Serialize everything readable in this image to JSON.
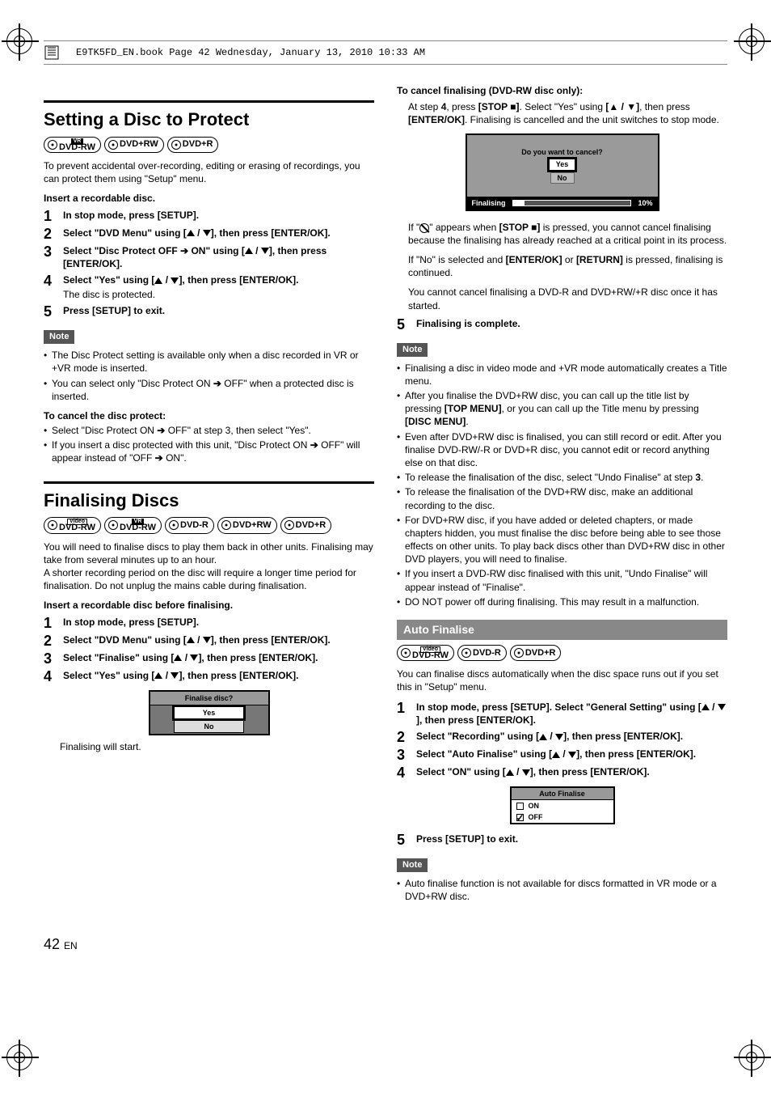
{
  "header_line": "E9TK5FD_EN.book  Page 42  Wednesday, January 13, 2010  10:33 AM",
  "left": {
    "section1_title": "Setting a Disc to Protect",
    "badges1": [
      "DVD-RW",
      "DVD+RW",
      "DVD+R"
    ],
    "badges1_sup": [
      "VR",
      "",
      ""
    ],
    "intro1": "To prevent accidental over-recording, editing or erasing of recordings, you can protect them using \"Setup\" menu.",
    "insert1": "Insert a recordable disc.",
    "steps1": [
      {
        "n": "1",
        "main": "In stop mode, press [SETUP]."
      },
      {
        "n": "2",
        "main": "Select \"DVD Menu\" using [▲ / ▼], then press [ENTER/OK]."
      },
      {
        "n": "3",
        "main": "Select \"Disc Protect OFF ➔ ON\" using [▲ / ▼], then press [ENTER/OK]."
      },
      {
        "n": "4",
        "main": "Select \"Yes\" using [▲ / ▼], then press [ENTER/OK].",
        "sub": "The disc is protected."
      },
      {
        "n": "5",
        "main": "Press [SETUP] to exit."
      }
    ],
    "note1_label": "Note",
    "note1_bullets": [
      "The Disc Protect setting is available only when a disc recorded in VR or +VR mode is inserted.",
      "You can select only \"Disc Protect ON ➔ OFF\" when a protected disc is inserted."
    ],
    "cancel_protect_h": "To cancel the disc protect:",
    "cancel_protect_bullets": [
      "Select \"Disc Protect ON ➔ OFF\" at step 3, then select \"Yes\".",
      "If you insert a disc protected with this unit, \"Disc Protect ON ➔ OFF\" will appear instead of \"OFF ➔ ON\"."
    ],
    "section2_title": "Finalising Discs",
    "badges2": [
      "DVD-RW",
      "DVD-RW",
      "DVD-R",
      "DVD+RW",
      "DVD+R"
    ],
    "badges2_sup": [
      "Video",
      "VR",
      "",
      "",
      ""
    ],
    "intro2": "You will need to finalise discs to play them back in other units. Finalising may take from several minutes up to an hour.\nA shorter recording period on the disc will require a longer time period for finalisation. Do not unplug the mains cable during finalisation.",
    "insert2": "Insert a recordable disc before finalising.",
    "steps2": [
      {
        "n": "1",
        "main": "In stop mode, press [SETUP]."
      },
      {
        "n": "2",
        "main": "Select \"DVD Menu\" using [▲ / ▼], then press [ENTER/OK]."
      },
      {
        "n": "3",
        "main": "Select \"Finalise\" using [▲ / ▼], then press [ENTER/OK]."
      },
      {
        "n": "4",
        "main": "Select \"Yes\" using [▲ / ▼], then press [ENTER/OK]."
      }
    ],
    "finalise_box": {
      "title": "Finalise disc?",
      "yes": "Yes",
      "no": "No"
    },
    "finalise_start": "Finalising will start."
  },
  "right": {
    "cancel_fin_h": "To cancel finalising (DVD-RW disc only):",
    "cancel_fin_p1_a": "At step ",
    "cancel_fin_p1_b": "4",
    "cancel_fin_p1_c": ", press ",
    "cancel_fin_p1_d": "[STOP ■]",
    "cancel_fin_p1_e": ". Select \"Yes\" using ",
    "cancel_fin_p1_f": "[▲ / ▼]",
    "cancel_fin_p1_g": ", then press ",
    "cancel_fin_p1_h": "[ENTER/OK]",
    "cancel_fin_p1_i": ". Finalising is cancelled and the unit switches to stop mode.",
    "cancel_box": {
      "q": "Do you want to cancel?",
      "yes": "Yes",
      "no": "No",
      "bar_label": "Finalising",
      "pct": "10%"
    },
    "cancel_fin_p2_a": "If \"",
    "cancel_fin_p2_b": "\" appears when ",
    "cancel_fin_p2_c": "[STOP ■]",
    "cancel_fin_p2_d": " is pressed, you cannot cancel finalising because the finalising has already reached at a critical point in its process.",
    "cancel_fin_p3_a": "If \"No\" is selected and ",
    "cancel_fin_p3_b": "[ENTER/OK]",
    "cancel_fin_p3_c": " or ",
    "cancel_fin_p3_d": "[RETURN]",
    "cancel_fin_p3_e": " is pressed, finalising is continued.",
    "cancel_fin_p4": "You cannot cancel finalising a DVD-R and DVD+RW/+R disc once it has started.",
    "step5": {
      "n": "5",
      "main": "Finalising is complete."
    },
    "note2_label": "Note",
    "note2_bullets": [
      "Finalising a disc in video mode and +VR mode automatically creates a Title menu.",
      "After you finalise the DVD+RW disc, you can call up the title list by pressing [TOP MENU], or you can call up the Title menu by pressing [DISC MENU].",
      "Even after DVD+RW disc is finalised, you can still record or edit. After you finalise DVD-RW/-R or DVD+R disc, you cannot edit or record anything else on that disc.",
      "To release the finalisation of the disc, select \"Undo Finalise\" at step 3.",
      "To release the finalisation of the DVD+RW disc, make an additional recording to the disc.",
      "For DVD+RW disc, if you have added or deleted chapters, or made chapters hidden, you must finalise the disc before being able to see those effects on other units. To play back discs other than DVD+RW disc in other DVD players, you will need to finalise.",
      "If you insert a DVD-RW disc finalised with this unit, \"Undo Finalise\" will appear instead of \"Finalise\".",
      "DO NOT power off during finalising. This may result in a malfunction."
    ],
    "auto_fin_h": "Auto Finalise",
    "badges3": [
      "DVD-RW",
      "DVD-R",
      "DVD+R"
    ],
    "badges3_sup": [
      "Video",
      "",
      ""
    ],
    "auto_intro": "You can finalise discs automatically when the disc space runs out if you set this in \"Setup\" menu.",
    "auto_steps": [
      {
        "n": "1",
        "main": "In stop mode, press [SETUP]. Select \"General Setting\" using [▲ / ▼], then press [ENTER/OK]."
      },
      {
        "n": "2",
        "main": "Select \"Recording\" using [▲ / ▼], then press [ENTER/OK]."
      },
      {
        "n": "3",
        "main": "Select \"Auto Finalise\" using [▲ / ▼], then press [ENTER/OK]."
      },
      {
        "n": "4",
        "main": "Select \"ON\" using [▲ / ▼], then press [ENTER/OK]."
      }
    ],
    "auto_box": {
      "title": "Auto Finalise",
      "on": "ON",
      "off": "OFF"
    },
    "auto_step5": {
      "n": "5",
      "main": "Press [SETUP] to exit."
    },
    "note3_label": "Note",
    "note3_bullets": [
      "Auto finalise function is not available for discs formatted in VR mode or a DVD+RW disc."
    ]
  },
  "page_num": "42",
  "page_lang": "EN"
}
